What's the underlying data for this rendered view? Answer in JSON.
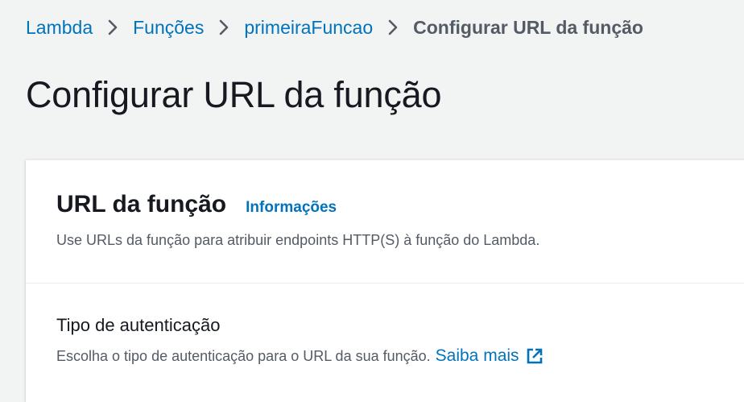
{
  "breadcrumb": {
    "items": [
      "Lambda",
      "Funções",
      "primeiraFuncao"
    ],
    "current": "Configurar URL da função"
  },
  "page": {
    "title": "Configurar URL da função"
  },
  "panel": {
    "title": "URL da função",
    "info_link": "Informações",
    "description": "Use URLs da função para atribuir endpoints HTTP(S) à função do Lambda."
  },
  "auth": {
    "label": "Tipo de autenticação",
    "description": "Escolha o tipo de autenticação para o URL da sua função.",
    "learn_more": "Saiba mais",
    "learn_more_icon": "external-link-icon"
  },
  "colors": {
    "link": "#0073bb",
    "text": "#16191f",
    "muted": "#545b64",
    "background": "#f2f3f3"
  }
}
